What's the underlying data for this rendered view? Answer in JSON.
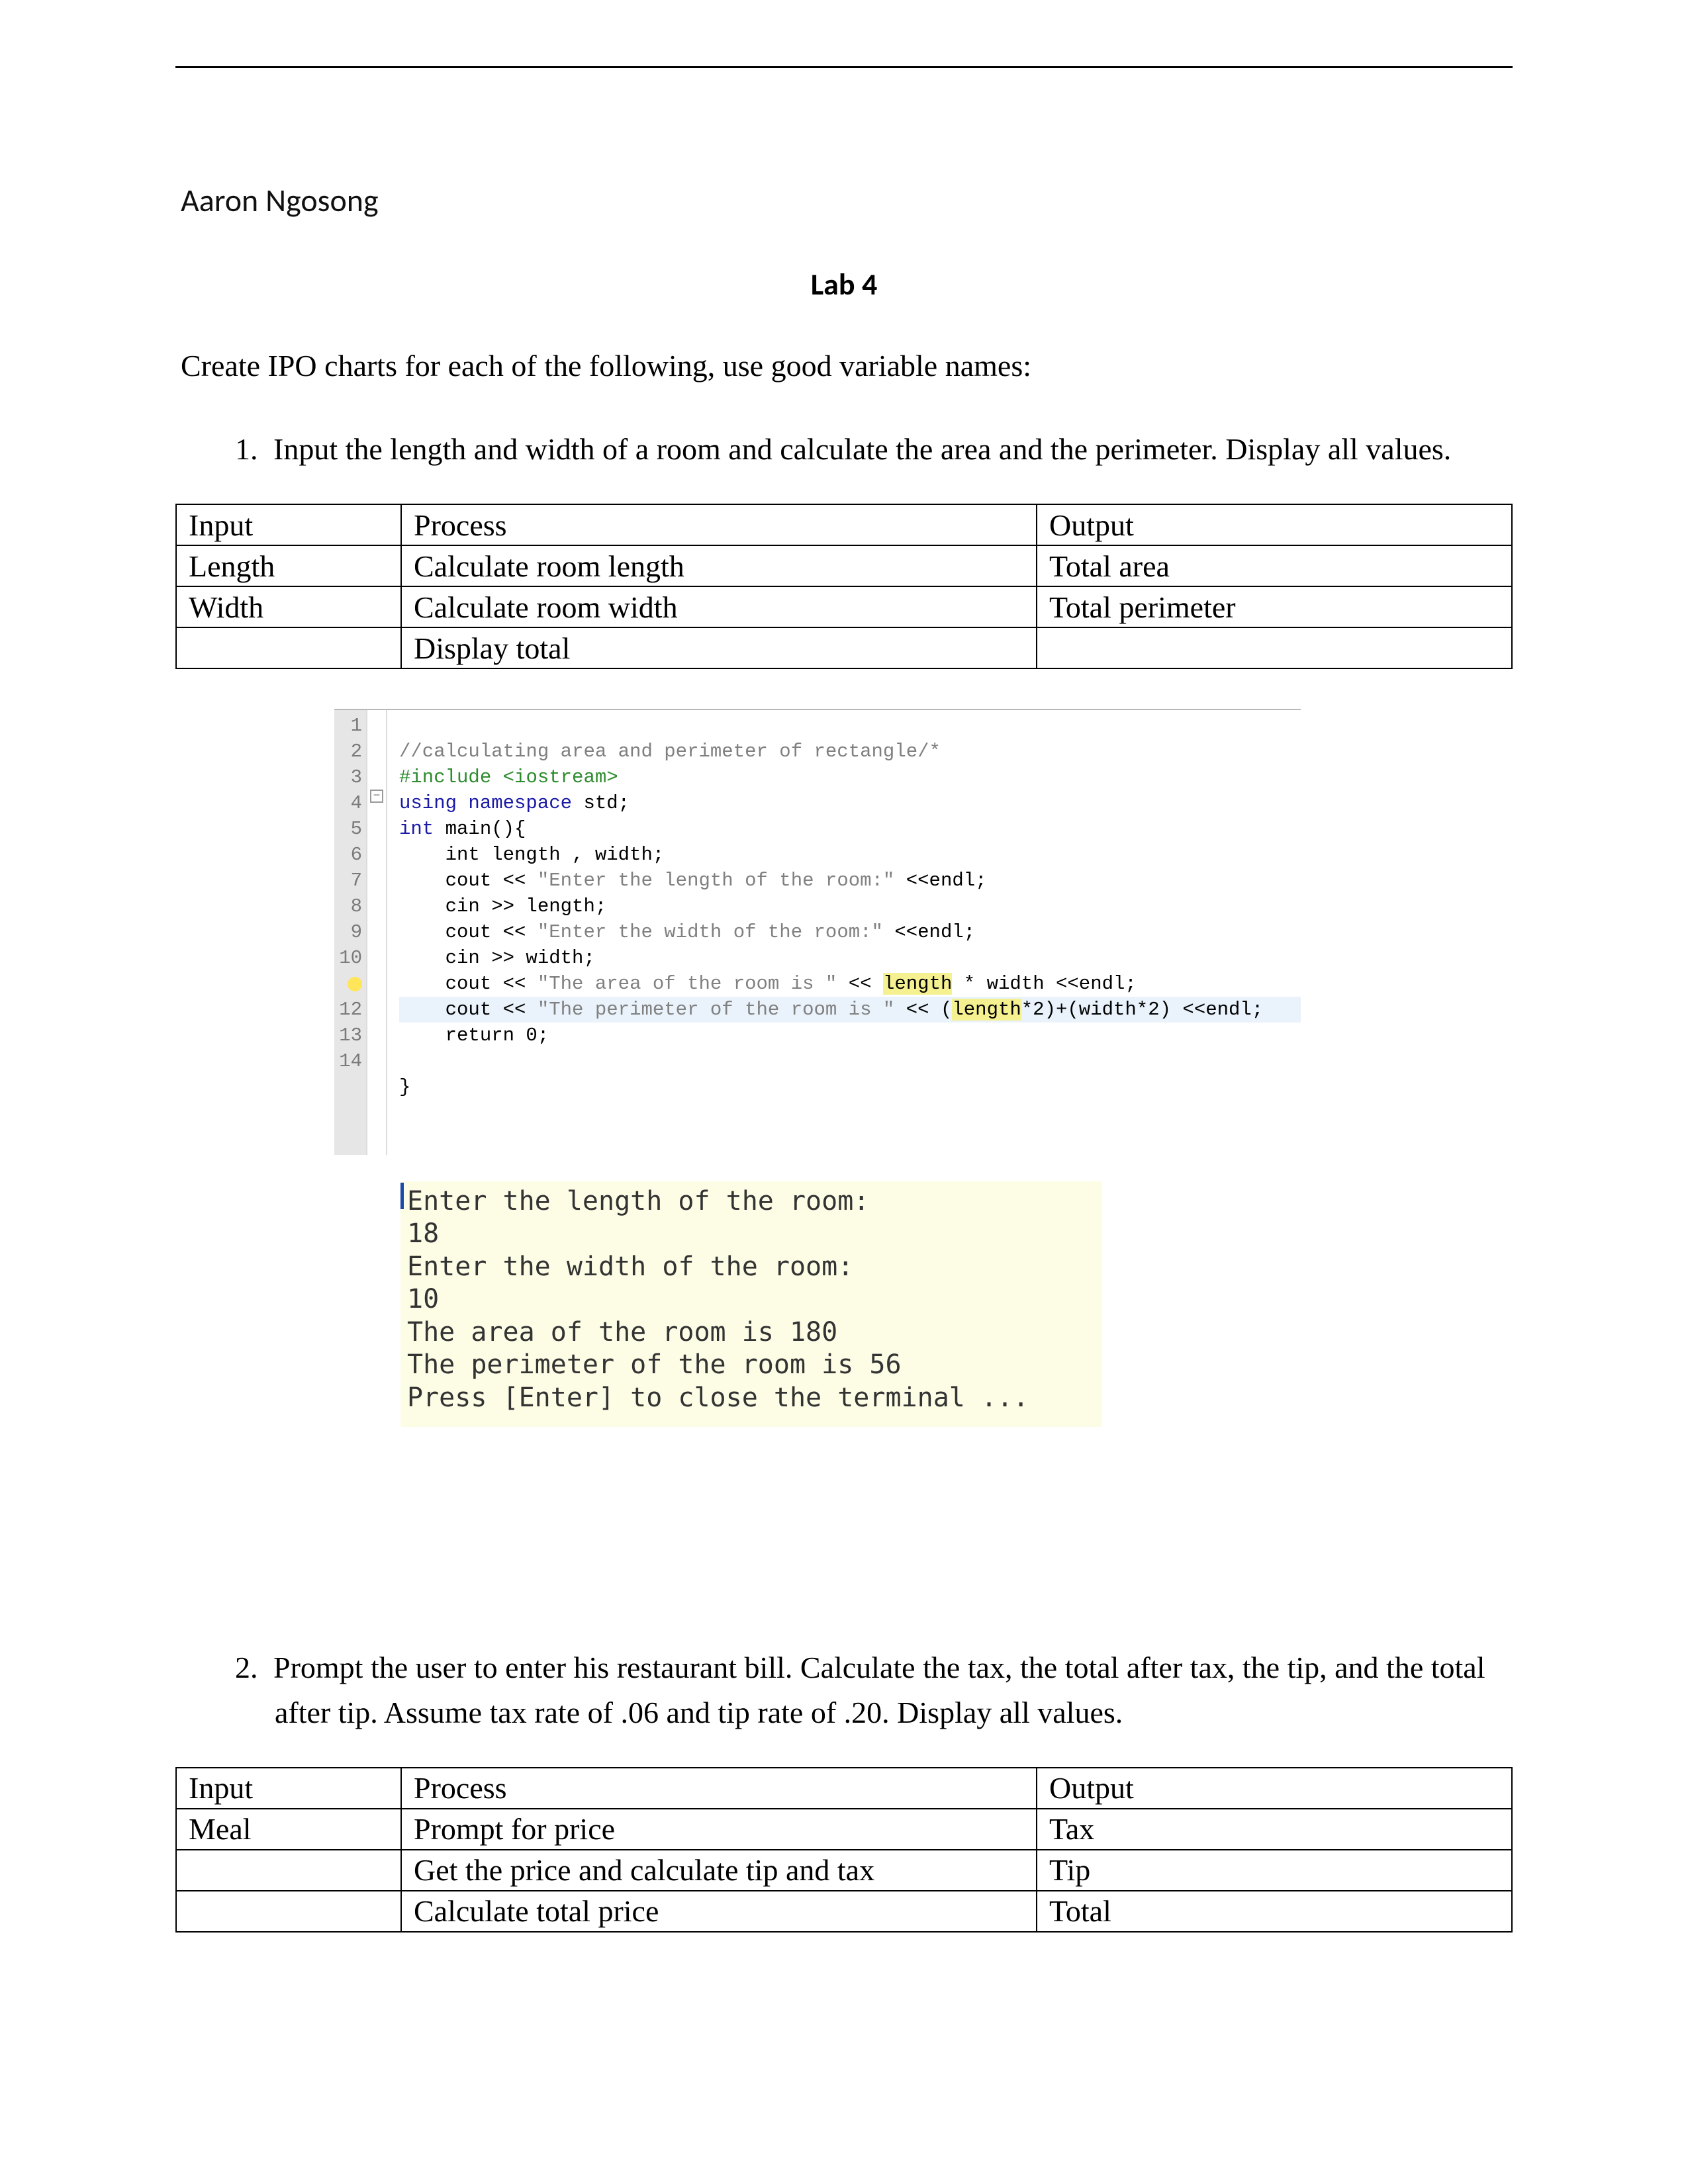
{
  "author": "Aaron Ngosong",
  "lab_title": "Lab 4",
  "intro": "Create IPO charts for each of the following, use good variable names:",
  "problems": [
    {
      "num": "1.",
      "text": "Input the length and width of a room and calculate the area and the perimeter. Display all values."
    },
    {
      "num": "2.",
      "text": "Prompt the user to enter his restaurant bill. Calculate the tax, the total after tax, the tip, and the total after tip. Assume tax rate of .06 and tip rate of .20. Display all values."
    }
  ],
  "ipo_headers": {
    "input": "Input",
    "process": "Process",
    "output": "Output"
  },
  "ipo1": {
    "rows": [
      {
        "input": "Length",
        "process": "Calculate room length",
        "output": "Total area"
      },
      {
        "input": "Width",
        "process": "Calculate room width",
        "output": "Total perimeter"
      },
      {
        "input": "",
        "process": "Display total",
        "output": ""
      }
    ]
  },
  "ipo2": {
    "rows": [
      {
        "input": "Meal",
        "process": "Prompt for price",
        "output": "Tax"
      },
      {
        "input": "",
        "process": "Get the price and calculate tip and tax",
        "output": "Tip"
      },
      {
        "input": "",
        "process": "Calculate total price",
        "output": "Total"
      }
    ]
  },
  "code": {
    "line_numbers": [
      "1",
      "2",
      "3",
      "4",
      "5",
      "6",
      "7",
      "8",
      "9",
      "10",
      "",
      "12",
      "13",
      "14"
    ],
    "l1_comment": "//calculating area and perimeter of rectangle/*",
    "l2_a": "#include ",
    "l2_b": "<iostream>",
    "l3_a": "using namespace ",
    "l3_b": "std;",
    "l4_a": "int ",
    "l4_b": "main(){",
    "l5": "    int length , width;",
    "l6_a": "    cout << ",
    "l6_b": "\"Enter the length of the room:\"",
    "l6_c": " <<endl;",
    "l7": "    cin >> length;",
    "l8_a": "    cout << ",
    "l8_b": "\"Enter the width of the room:\"",
    "l8_c": " <<endl;",
    "l9": "    cin >> width;",
    "l10_a": "    cout << ",
    "l10_b": "\"The area of the room is \"",
    "l10_c": " << ",
    "l10_d": "length",
    "l10_e": " * width <<endl;",
    "l11_a": "    cout << ",
    "l11_b": "\"The perimeter of the room is \"",
    "l11_c": " << (",
    "l11_d": "length",
    "l11_e": "*2)+(width*2) <<endl;",
    "l12": "    return 0;",
    "l14": "}"
  },
  "console": "Enter the length of the room:\n18\nEnter the width of the room:\n10\nThe area of the room is 180\nThe perimeter of the room is 56\nPress [Enter] to close the terminal ..."
}
